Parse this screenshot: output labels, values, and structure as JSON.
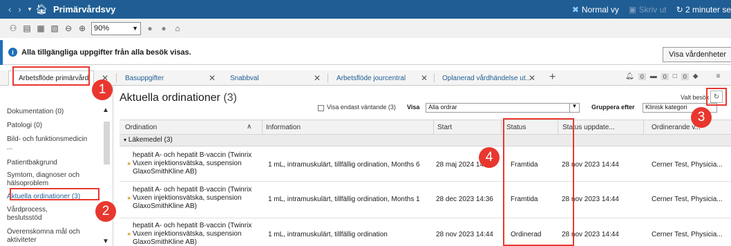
{
  "titlebar": {
    "title": "Primärvårdsvy",
    "normal_view": "Normal vy",
    "screen_btn": "Skriv ut",
    "refresh_time": "2 minuter se"
  },
  "toolbar": {
    "zoom": "90%"
  },
  "infobar": {
    "message": "Alla tillgängliga uppgifter från alla besök visas.",
    "button": "Visa vårdenheter"
  },
  "tabs": [
    {
      "label": "Arbetsflöde primärvård"
    },
    {
      "label": "Basuppgifter"
    },
    {
      "label": "Snabbval"
    },
    {
      "label": "Arbetsflöde jourcentral"
    },
    {
      "label": "Oplanerad vårdhändelse ut..."
    }
  ],
  "tab_badges": [
    "0",
    "0",
    "0"
  ],
  "sidebar": {
    "items": [
      {
        "label": "Dokumentation (0)"
      },
      {
        "label": "Patologi (0)"
      },
      {
        "label": "Bild- och funktionsmedicin ..."
      },
      {
        "label": "Patientbakgrund"
      },
      {
        "label": "Symtom, diagnoser och hälsoproblem"
      },
      {
        "label": "Aktuella ordinationer (3)"
      },
      {
        "label": "Vårdprocess, beslutsstöd"
      },
      {
        "label": "Överenskomna mål och aktiviteter"
      }
    ]
  },
  "main": {
    "title": "Aktuella ordinationer",
    "count": "(3)",
    "valt_besok": "Valt besök",
    "filter": {
      "checkbox_label": "Visa endast väntande (3)",
      "visa_label": "Visa",
      "visa_value": "Alla ordrar",
      "group_label": "Gruppera efter",
      "group_value": "Klinisk kategori"
    },
    "columns": [
      "Ordination",
      "Information",
      "Start",
      "Status",
      "Status uppdate...",
      "Ordinerande v..."
    ],
    "group": "Läkemedel (3)",
    "rows": [
      {
        "med": "hepatit A- och hepatit B-vaccin (Twinrix Vuxen injektionsvätska, suspension GlaxoSmithKline AB)",
        "info": "1 mL, intramuskulärt, tillfällig ordination, Months 6",
        "start": "28 maj 2024 14",
        "status": "Framtida",
        "updated": "28 nov 2023 14:44",
        "orderer": "Cerner Test, Physicia..."
      },
      {
        "med": "hepatit A- och hepatit B-vaccin (Twinrix Vuxen injektionsvätska, suspension GlaxoSmithKline AB)",
        "info": "1 mL, intramuskulärt, tillfällig ordination, Months 1",
        "start": "28 dec 2023 14:36",
        "status": "Framtida",
        "updated": "28 nov 2023 14:44",
        "orderer": "Cerner Test, Physicia..."
      },
      {
        "med": "hepatit A- och hepatit B-vaccin (Twinrix Vuxen injektionsvätska, suspension GlaxoSmithKline AB)",
        "info": "1 mL, intramuskulärt, tillfällig ordination",
        "start": "28 nov 2023 14:44",
        "status": "Ordinerad",
        "updated": "28 nov 2023 14:44",
        "orderer": "Cerner Test, Physicia..."
      }
    ]
  },
  "markers": [
    "1",
    "2",
    "3",
    "4"
  ],
  "colors": {
    "titlebar": "#1f5d94",
    "callout": "#e8372f",
    "link": "#1f5d94"
  }
}
